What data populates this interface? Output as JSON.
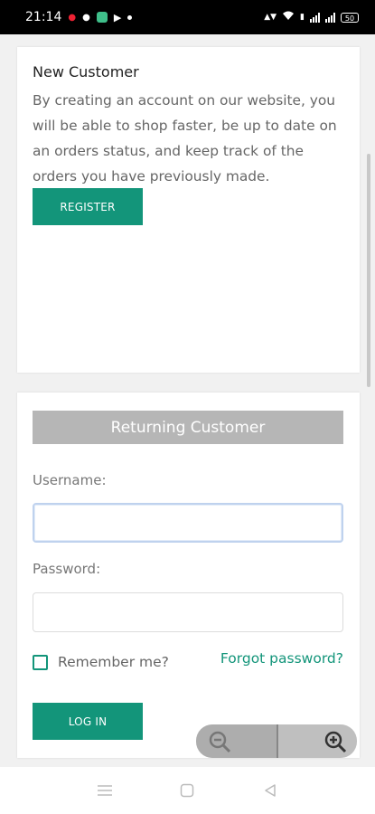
{
  "status_bar": {
    "time": "21:14",
    "battery": "50"
  },
  "new_customer": {
    "title": "New Customer",
    "description": "By creating an account on our website, you will be able to shop faster, be up to date on an orders status, and keep track of the orders you have previously made.",
    "register_label": "REGISTER"
  },
  "returning_customer": {
    "title": "Returning Customer",
    "username_label": "Username:",
    "username_value": "",
    "password_label": "Password:",
    "password_value": "",
    "remember_label": "Remember me?",
    "forgot_label": "Forgot password?",
    "login_label": "LOG IN"
  },
  "colors": {
    "accent": "#13957a",
    "header_gray": "#b6b6b6"
  },
  "icons": {
    "zoom_out": "zoom-out-icon",
    "zoom_in": "zoom-in-icon",
    "nav_menu": "menu-icon",
    "nav_home": "home-icon",
    "nav_back": "back-icon"
  }
}
